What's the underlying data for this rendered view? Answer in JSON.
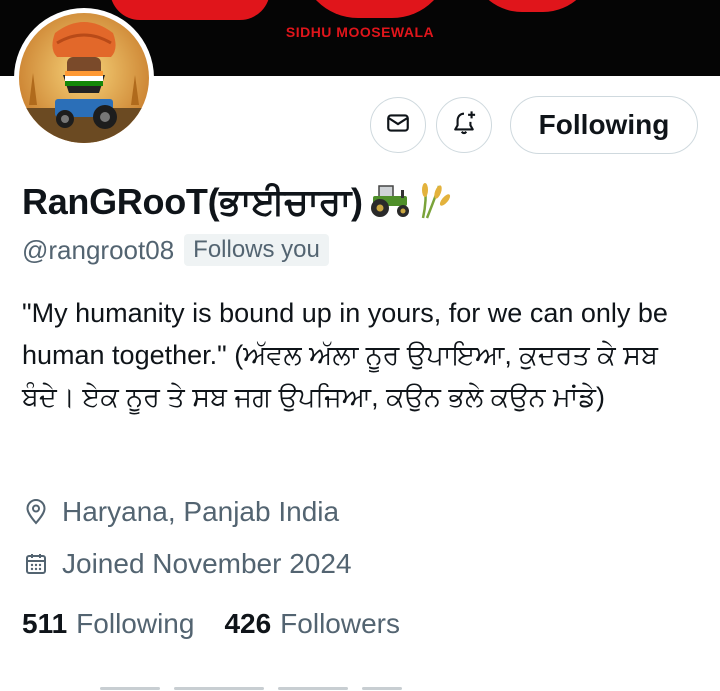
{
  "banner": {
    "artist_text": "SIDHU MOOSEWALA"
  },
  "actions": {
    "message_icon": "mail-icon",
    "notify_icon": "bell-plus-icon",
    "following_label": "Following"
  },
  "profile": {
    "display_name": "RanGRooT(ਭਾਈਚਾਰਾ)",
    "name_emojis": [
      "tractor-icon",
      "sheaf-of-rice-icon"
    ],
    "handle": "@rangroot08",
    "follows_you": "Follows you",
    "bio": "\"My humanity is bound up in yours, for we can only be human together.\" (ਅੱਵਲ ਅੱਲਾ ਨੂਰ ਉਪਾਇਆ, ਕੁਦਰਤ ਕੇ ਸਬ ਬੰਦੇ। ਏਕ ਨੂਰ ਤੇ ਸਬ ਜਗ ਉਪਜਿਆ, ਕਉਨ ਭਲੇ ਕਉਨ ਮਾਂਡੇ)",
    "location": "Haryana, Panjab India",
    "joined": "Joined November 2024"
  },
  "stats": {
    "following_count": "511",
    "following_label": "Following",
    "followers_count": "426",
    "followers_label": "Followers"
  },
  "colors": {
    "text": "#0f1419",
    "secondary": "#536471",
    "border": "#cfd9de",
    "banner": "#050505",
    "banner_red": "#e0151b"
  }
}
